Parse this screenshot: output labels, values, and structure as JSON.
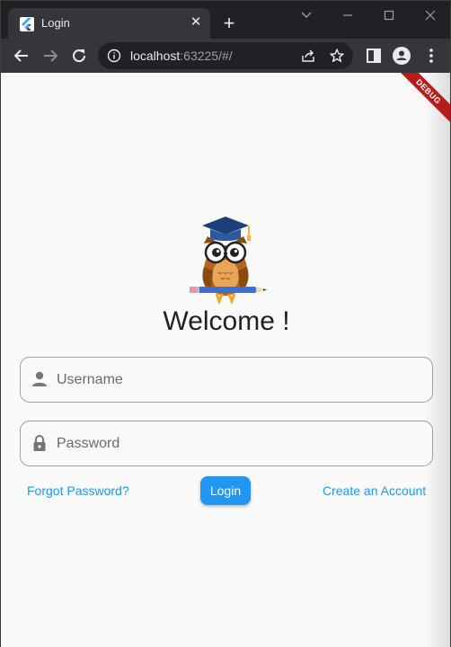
{
  "browser": {
    "tab_title": "Login",
    "tab_close_icon": "close-icon",
    "new_tab_icon": "plus-icon",
    "url_host": "localhost",
    "url_rest": ":63225/#/"
  },
  "app": {
    "debug_banner": "DEBUG",
    "welcome": "Welcome !",
    "username": {
      "placeholder": "Username",
      "value": "",
      "icon": "person-icon"
    },
    "password": {
      "placeholder": "Password",
      "value": "",
      "icon": "lock-icon"
    },
    "forgot_label": "Forgot Password?",
    "login_label": "Login",
    "create_label": "Create an Account"
  },
  "colors": {
    "accent": "#2196f3",
    "page_bg": "#fafafa",
    "chrome_dark": "#202124",
    "chrome_toolbar": "#35363a"
  }
}
